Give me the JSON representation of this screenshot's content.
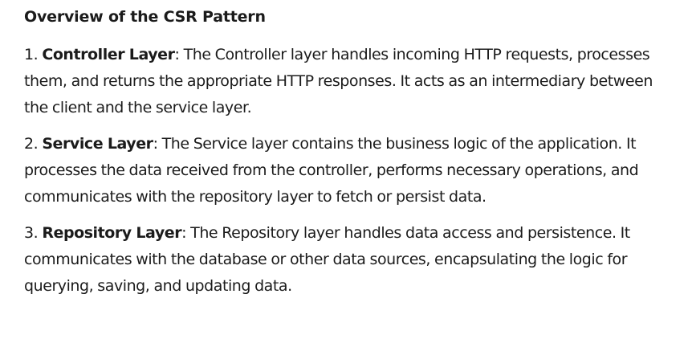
{
  "heading": "Overview of the CSR Pattern",
  "items": [
    {
      "number": "1. ",
      "term": "Controller Layer",
      "description": ": The Controller layer handles incoming HTTP requests, processes them, and returns the appropriate HTTP responses. It acts as an intermediary between the client and the service layer."
    },
    {
      "number": "2. ",
      "term": "Service Layer",
      "description": ": The Service layer contains the business logic of the application. It processes the data received from the controller, performs necessary operations, and communicates with the repository layer to fetch or persist data."
    },
    {
      "number": "3. ",
      "term": "Repository Layer",
      "description": ": The Repository layer handles data access and persistence. It communicates with the database or other data sources, encapsulating the logic for querying, saving, and updating data."
    }
  ]
}
